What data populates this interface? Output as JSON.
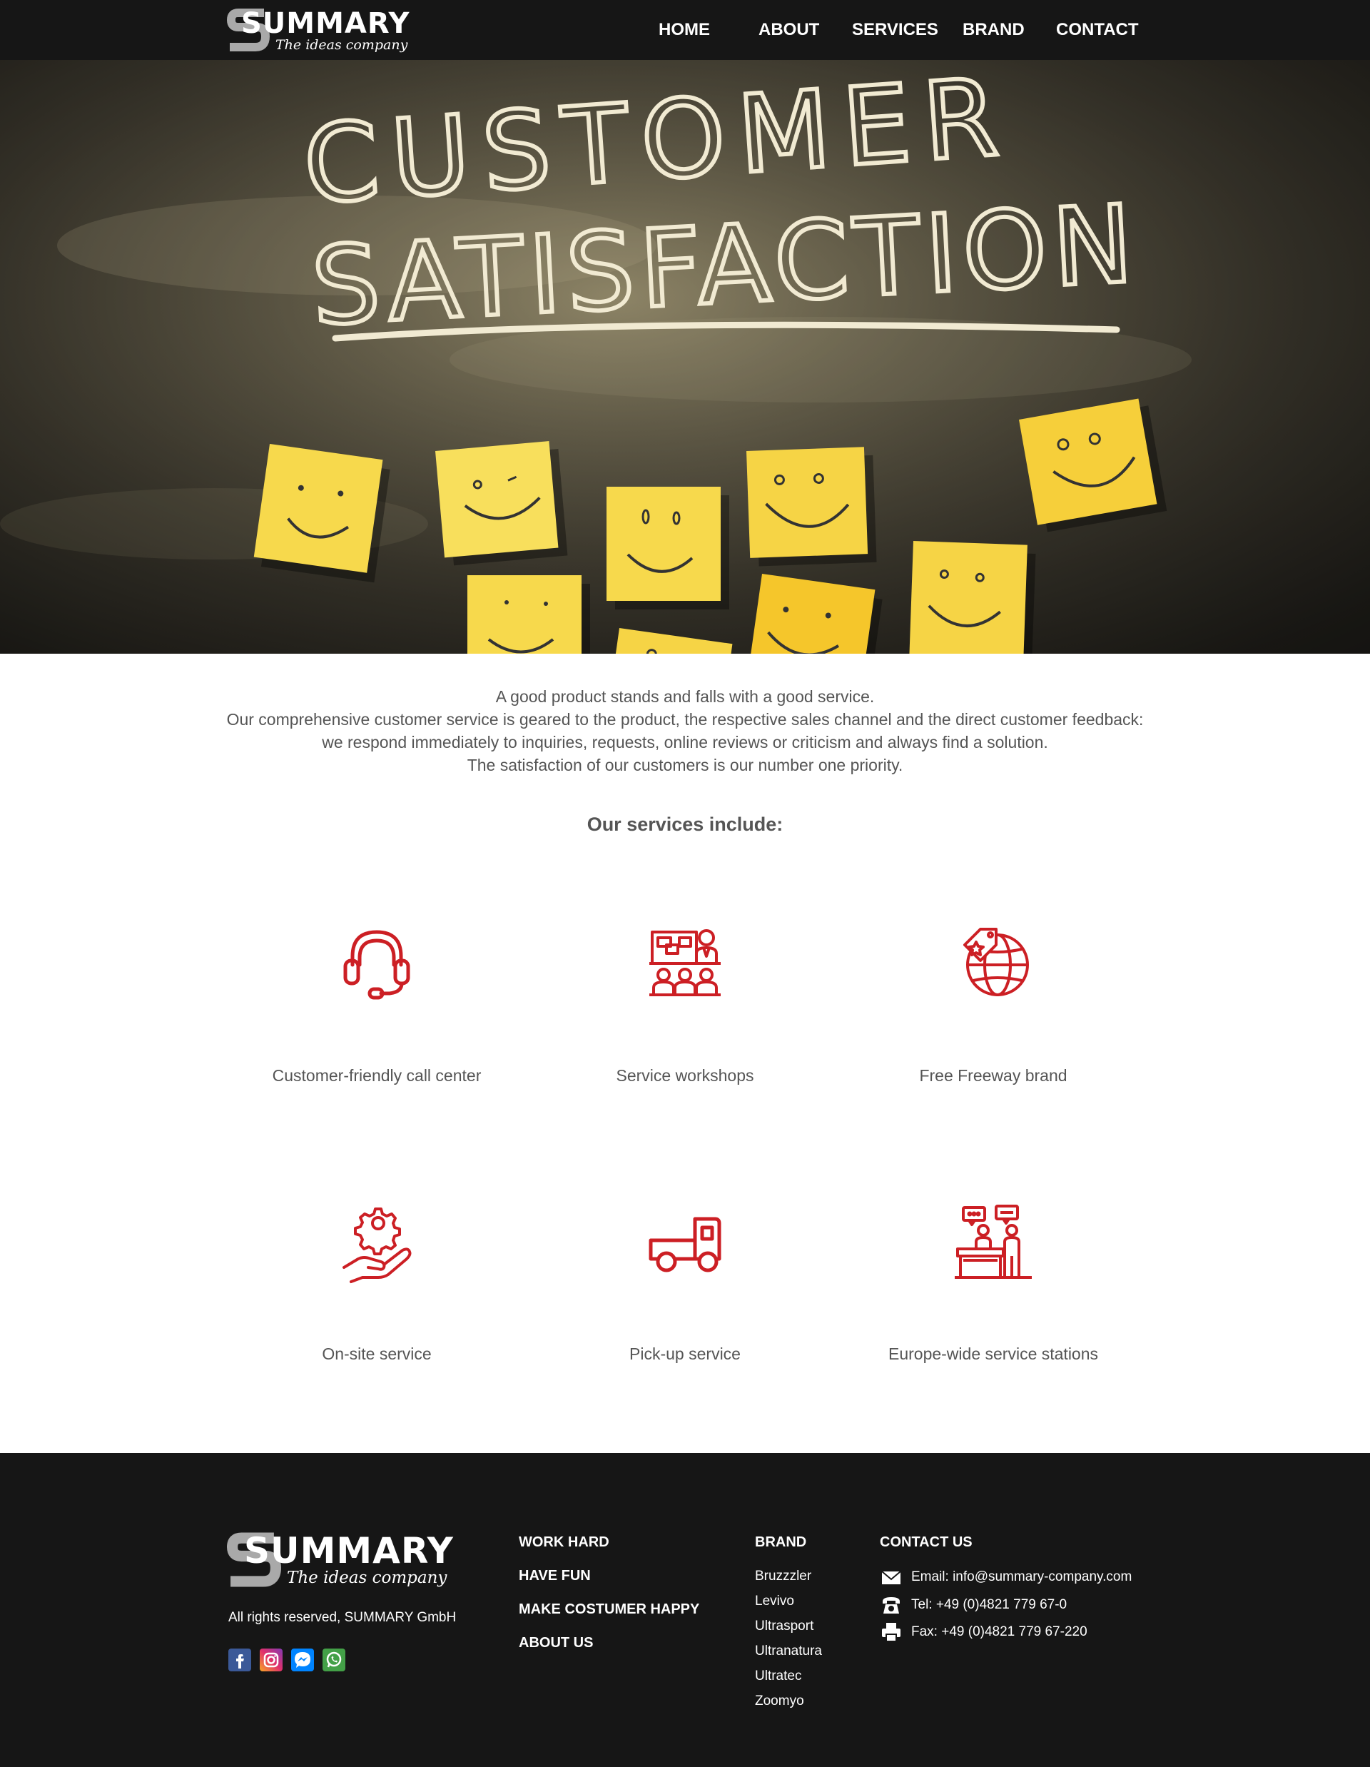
{
  "brand": {
    "logo_word": "SUMMARY",
    "logo_tagline": "The ideas company"
  },
  "nav": {
    "items": [
      {
        "label": "HOME"
      },
      {
        "label": "ABOUT"
      },
      {
        "label": "SERVICES"
      },
      {
        "label": "BRAND"
      },
      {
        "label": "CONTACT"
      }
    ]
  },
  "hero": {
    "chalk_line_1": "CUSTOMER",
    "chalk_line_2": "SATISFACTION"
  },
  "intro": {
    "line_1": "A good product stands and falls with a good service.",
    "line_2": "Our comprehensive customer service is geared to the product, the respective sales channel and the direct customer feedback: we respond immediately to inquiries, requests, online reviews or criticism and always find a solution.",
    "line_3": "The satisfaction of our customers is our number one priority."
  },
  "services": {
    "heading": "Our services include:",
    "items": [
      {
        "label": "Customer-friendly call center",
        "icon": "headset-icon"
      },
      {
        "label": "Service workshops",
        "icon": "workshop-icon"
      },
      {
        "label": "Free Freeway brand",
        "icon": "globe-tag-icon"
      },
      {
        "label": "On-site service",
        "icon": "gear-hand-icon"
      },
      {
        "label": "Pick-up service",
        "icon": "truck-icon"
      },
      {
        "label": "Europe-wide service stations",
        "icon": "service-desk-icon"
      }
    ]
  },
  "footer": {
    "rights": "All rights reserved, SUMMARY GmbH",
    "socials": [
      "facebook-icon",
      "instagram-icon",
      "messenger-icon",
      "whatsapp-icon"
    ],
    "links": [
      "WORK HARD",
      "HAVE FUN",
      "MAKE COSTUMER HAPPY",
      "ABOUT US"
    ],
    "brand_heading": "BRAND",
    "brands": [
      "Bruzzzler",
      "Levivo",
      "Ultrasport",
      "Ultranatura",
      "Ultratec",
      "Zoomyo"
    ],
    "contact_heading": "CONTACT US",
    "email": "Email: info@summary-company.com",
    "tel": "Tel:  +49 (0)4821 779 67-0",
    "fax": "Fax: +49 (0)4821 779 67-220"
  },
  "colors": {
    "nav_bg": "#161616",
    "footer_bg": "#161616",
    "icon_red": "#cc1f24",
    "text_gray": "#555555",
    "note_yellow": "#f7d94c"
  }
}
